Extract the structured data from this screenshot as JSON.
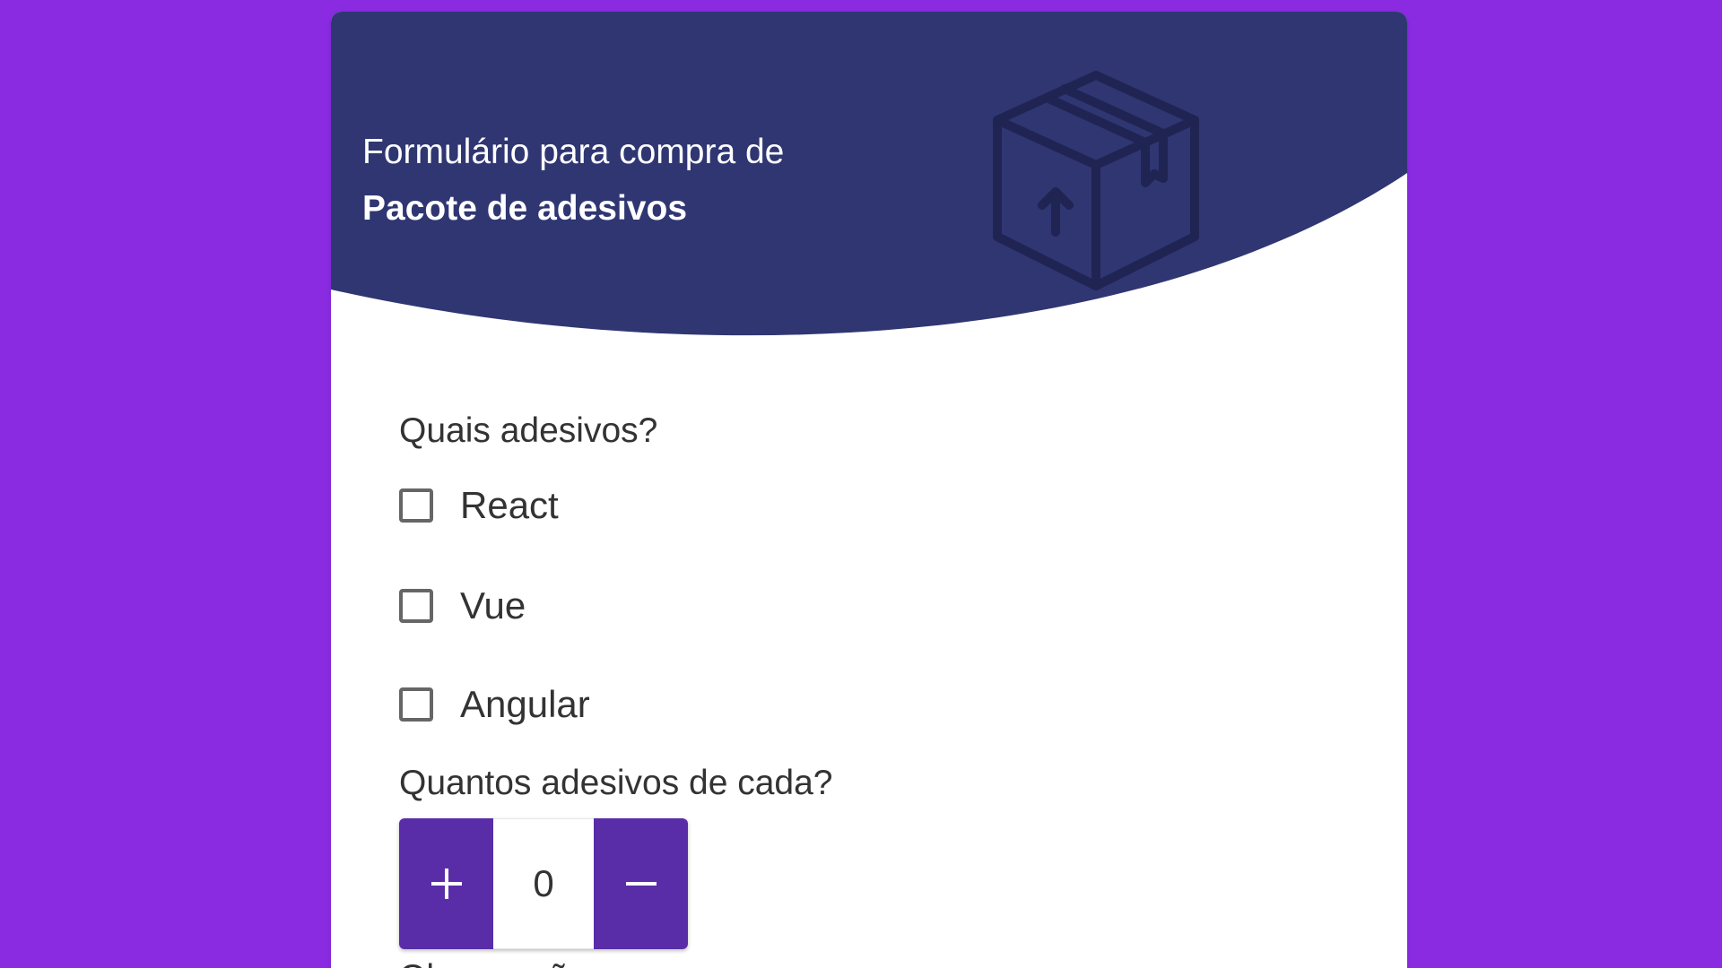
{
  "header": {
    "line1": "Formulário para compra de",
    "line2": "Pacote de adesivos",
    "icon": "package-box-icon"
  },
  "form": {
    "question_which": "Quais adesivos?",
    "options": [
      {
        "label": "React",
        "checked": false
      },
      {
        "label": "Vue",
        "checked": false
      },
      {
        "label": "Angular",
        "checked": false
      }
    ],
    "question_quantity": "Quantos adesivos de cada?",
    "quantity": {
      "value": "0",
      "increment_icon": "plus-icon",
      "decrement_icon": "minus-icon"
    },
    "question_notes": "Observações"
  },
  "colors": {
    "background": "#8a2be2",
    "header": "#2f3672",
    "stepper_button": "#5a2da8",
    "card": "#ffffff"
  }
}
